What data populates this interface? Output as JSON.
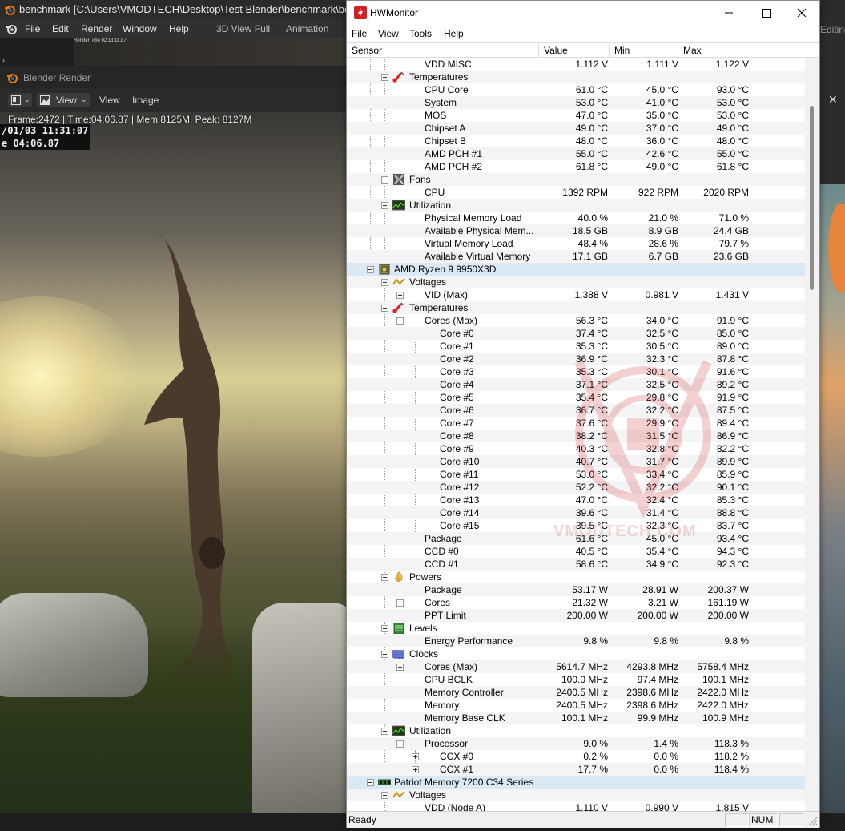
{
  "blender": {
    "title": "benchmark [C:\\Users\\VMODTECH\\Desktop\\Test Blender\\benchmark\\benchma",
    "menu": [
      "File",
      "Edit",
      "Render",
      "Window",
      "Help"
    ],
    "workspace_tabs": [
      "3D View Full",
      "Animation"
    ],
    "right_tab_fragment": "Editing",
    "thumb_caption": "RenderTime 02:13:11.87",
    "render_window_title": "Blender Render",
    "toolbar": {
      "view_dd": "View",
      "view": "View",
      "image": "Image"
    },
    "stats": "Frame:2472 | Time:04:06.87 | Mem:8125M, Peak: 8127M",
    "stamp_line1": "/01/03 11:31:07",
    "stamp_line2": "e 04:06.87"
  },
  "hwmonitor": {
    "title": "HWMonitor",
    "menu": [
      "File",
      "View",
      "Tools",
      "Help"
    ],
    "columns": [
      "Sensor",
      "Value",
      "Min",
      "Max"
    ],
    "status": {
      "left": "Ready",
      "num": "NUM"
    },
    "watermark": "VMODTECH.COM",
    "rows": [
      {
        "level": 3,
        "label": "VDD MISC",
        "value": "1.112 V",
        "min": "1.111 V",
        "max": "1.122 V"
      },
      {
        "level": 2,
        "label": "Temperatures",
        "icon": "thermometer",
        "exp": "minus"
      },
      {
        "level": 3,
        "label": "CPU Core",
        "value": "61.0 °C",
        "min": "45.0 °C",
        "max": "93.0 °C"
      },
      {
        "level": 3,
        "label": "System",
        "value": "53.0 °C",
        "min": "41.0 °C",
        "max": "53.0 °C"
      },
      {
        "level": 3,
        "label": "MOS",
        "value": "47.0 °C",
        "min": "35.0 °C",
        "max": "53.0 °C"
      },
      {
        "level": 3,
        "label": "Chipset A",
        "value": "49.0 °C",
        "min": "37.0 °C",
        "max": "49.0 °C"
      },
      {
        "level": 3,
        "label": "Chipset B",
        "value": "48.0 °C",
        "min": "36.0 °C",
        "max": "48.0 °C"
      },
      {
        "level": 3,
        "label": "AMD PCH #1",
        "value": "55.0 °C",
        "min": "42.6 °C",
        "max": "55.0 °C"
      },
      {
        "level": 3,
        "label": "AMD PCH #2",
        "value": "61.8 °C",
        "min": "49.0 °C",
        "max": "61.8 °C"
      },
      {
        "level": 2,
        "label": "Fans",
        "icon": "fan",
        "exp": "minus"
      },
      {
        "level": 3,
        "label": "CPU",
        "value": "1392 RPM",
        "min": "922 RPM",
        "max": "2020 RPM"
      },
      {
        "level": 2,
        "label": "Utilization",
        "icon": "utilization",
        "exp": "minus"
      },
      {
        "level": 3,
        "label": "Physical Memory Load",
        "value": "40.0 %",
        "min": "21.0 %",
        "max": "71.0 %"
      },
      {
        "level": 3,
        "label": "Available Physical Mem...",
        "value": "18.5 GB",
        "min": "8.9 GB",
        "max": "24.4 GB"
      },
      {
        "level": 3,
        "label": "Virtual Memory Load",
        "value": "48.4 %",
        "min": "28.6 %",
        "max": "79.7 %"
      },
      {
        "level": 3,
        "label": "Available Virtual Memory",
        "value": "17.1 GB",
        "min": "6.7 GB",
        "max": "23.6 GB"
      },
      {
        "level": 1,
        "label": "AMD Ryzen 9 9950X3D",
        "icon": "cpu",
        "exp": "minus",
        "highlight": true
      },
      {
        "level": 2,
        "label": "Voltages",
        "icon": "voltage",
        "exp": "minus"
      },
      {
        "level": 3,
        "label": "VID (Max)",
        "value": "1.388 V",
        "min": "0.981 V",
        "max": "1.431 V",
        "exp": "plus"
      },
      {
        "level": 2,
        "label": "Temperatures",
        "icon": "thermometer",
        "exp": "minus"
      },
      {
        "level": 3,
        "label": "Cores (Max)",
        "value": "56.3 °C",
        "min": "34.0 °C",
        "max": "91.9 °C",
        "exp": "minus"
      },
      {
        "level": 4,
        "label": "Core #0",
        "value": "37.4 °C",
        "min": "32.5 °C",
        "max": "85.0 °C"
      },
      {
        "level": 4,
        "label": "Core #1",
        "value": "35.3 °C",
        "min": "30.5 °C",
        "max": "89.0 °C"
      },
      {
        "level": 4,
        "label": "Core #2",
        "value": "36.9 °C",
        "min": "32.3 °C",
        "max": "87.8 °C"
      },
      {
        "level": 4,
        "label": "Core #3",
        "value": "35.3 °C",
        "min": "30.1 °C",
        "max": "91.6 °C"
      },
      {
        "level": 4,
        "label": "Core #4",
        "value": "37.1 °C",
        "min": "32.5 °C",
        "max": "89.2 °C"
      },
      {
        "level": 4,
        "label": "Core #5",
        "value": "35.4 °C",
        "min": "29.8 °C",
        "max": "91.9 °C"
      },
      {
        "level": 4,
        "label": "Core #6",
        "value": "36.7 °C",
        "min": "32.2 °C",
        "max": "87.5 °C"
      },
      {
        "level": 4,
        "label": "Core #7",
        "value": "37.6 °C",
        "min": "29.9 °C",
        "max": "89.4 °C"
      },
      {
        "level": 4,
        "label": "Core #8",
        "value": "38.2 °C",
        "min": "31.5 °C",
        "max": "86.9 °C"
      },
      {
        "level": 4,
        "label": "Core #9",
        "value": "40.3 °C",
        "min": "32.8 °C",
        "max": "82.2 °C"
      },
      {
        "level": 4,
        "label": "Core #10",
        "value": "40.7 °C",
        "min": "31.7 °C",
        "max": "89.9 °C"
      },
      {
        "level": 4,
        "label": "Core #11",
        "value": "53.0 °C",
        "min": "33.4 °C",
        "max": "85.9 °C"
      },
      {
        "level": 4,
        "label": "Core #12",
        "value": "52.2 °C",
        "min": "32.2 °C",
        "max": "90.1 °C"
      },
      {
        "level": 4,
        "label": "Core #13",
        "value": "47.0 °C",
        "min": "32.4 °C",
        "max": "85.3 °C"
      },
      {
        "level": 4,
        "label": "Core #14",
        "value": "39.6 °C",
        "min": "31.4 °C",
        "max": "88.8 °C"
      },
      {
        "level": 4,
        "label": "Core #15",
        "value": "39.5 °C",
        "min": "32.3 °C",
        "max": "83.7 °C"
      },
      {
        "level": 3,
        "label": "Package",
        "value": "61.6 °C",
        "min": "45.0 °C",
        "max": "93.4 °C"
      },
      {
        "level": 3,
        "label": "CCD #0",
        "value": "40.5 °C",
        "min": "35.4 °C",
        "max": "94.3 °C"
      },
      {
        "level": 3,
        "label": "CCD #1",
        "value": "58.6 °C",
        "min": "34.9 °C",
        "max": "92.3 °C"
      },
      {
        "level": 2,
        "label": "Powers",
        "icon": "power",
        "exp": "minus"
      },
      {
        "level": 3,
        "label": "Package",
        "value": "53.17 W",
        "min": "28.91 W",
        "max": "200.37 W"
      },
      {
        "level": 3,
        "label": "Cores",
        "value": "21.32 W",
        "min": "3.21 W",
        "max": "161.19 W",
        "exp": "plus"
      },
      {
        "level": 3,
        "label": "PPT Limit",
        "value": "200.00 W",
        "min": "200.00 W",
        "max": "200.00 W"
      },
      {
        "level": 2,
        "label": "Levels",
        "icon": "levels",
        "exp": "minus"
      },
      {
        "level": 3,
        "label": "Energy Performance",
        "value": "9.8 %",
        "min": "9.8 %",
        "max": "9.8 %"
      },
      {
        "level": 2,
        "label": "Clocks",
        "icon": "clocks",
        "exp": "minus"
      },
      {
        "level": 3,
        "label": "Cores (Max)",
        "value": "5614.7 MHz",
        "min": "4293.8 MHz",
        "max": "5758.4 MHz",
        "exp": "plus"
      },
      {
        "level": 3,
        "label": "CPU BCLK",
        "value": "100.0 MHz",
        "min": "97.4 MHz",
        "max": "100.1 MHz"
      },
      {
        "level": 3,
        "label": "Memory Controller",
        "value": "2400.5 MHz",
        "min": "2398.6 MHz",
        "max": "2422.0 MHz"
      },
      {
        "level": 3,
        "label": "Memory",
        "value": "2400.5 MHz",
        "min": "2398.6 MHz",
        "max": "2422.0 MHz"
      },
      {
        "level": 3,
        "label": "Memory Base CLK",
        "value": "100.1 MHz",
        "min": "99.9 MHz",
        "max": "100.9 MHz"
      },
      {
        "level": 2,
        "label": "Utilization",
        "icon": "utilization",
        "exp": "minus"
      },
      {
        "level": 3,
        "label": "Processor",
        "value": "9.0 %",
        "min": "1.4 %",
        "max": "118.3 %",
        "exp": "minus"
      },
      {
        "level": 4,
        "label": "CCX #0",
        "value": "0.2 %",
        "min": "0.0 %",
        "max": "118.2 %",
        "exp": "plus"
      },
      {
        "level": 4,
        "label": "CCX #1",
        "value": "17.7 %",
        "min": "0.0 %",
        "max": "118.4 %",
        "exp": "plus"
      },
      {
        "level": 1,
        "label": "Patriot Memory 7200 C34 Series",
        "icon": "ram",
        "exp": "minus",
        "highlight": true
      },
      {
        "level": 2,
        "label": "Voltages",
        "icon": "voltage",
        "exp": "minus"
      },
      {
        "level": 3,
        "label": "VDD (Node A)",
        "value": "1.110 V",
        "min": "0.990 V",
        "max": "1.815 V"
      }
    ]
  }
}
